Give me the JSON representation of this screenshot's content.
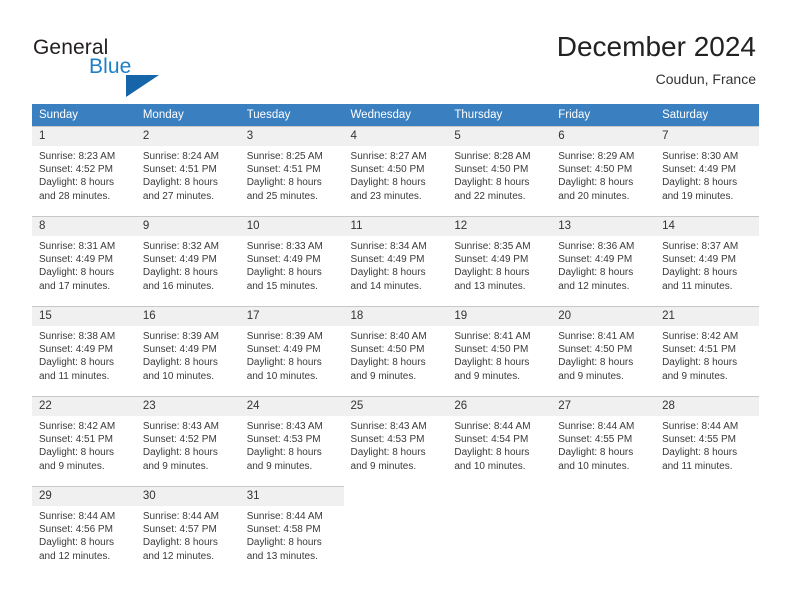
{
  "brand": {
    "name_part1": "General",
    "name_part2": "Blue",
    "accent_color": "#1f7fc4",
    "triangle_color": "#1565a8"
  },
  "header": {
    "title": "December 2024",
    "subtitle": "Coudun, France"
  },
  "calendar": {
    "header_bg": "#3a7fc0",
    "daynum_bg": "#f0f0f0",
    "weekday_headers": [
      "Sunday",
      "Monday",
      "Tuesday",
      "Wednesday",
      "Thursday",
      "Friday",
      "Saturday"
    ],
    "weeks": [
      [
        {
          "day": "1",
          "sunrise": "Sunrise: 8:23 AM",
          "sunset": "Sunset: 4:52 PM",
          "daylight1": "Daylight: 8 hours",
          "daylight2": "and 28 minutes."
        },
        {
          "day": "2",
          "sunrise": "Sunrise: 8:24 AM",
          "sunset": "Sunset: 4:51 PM",
          "daylight1": "Daylight: 8 hours",
          "daylight2": "and 27 minutes."
        },
        {
          "day": "3",
          "sunrise": "Sunrise: 8:25 AM",
          "sunset": "Sunset: 4:51 PM",
          "daylight1": "Daylight: 8 hours",
          "daylight2": "and 25 minutes."
        },
        {
          "day": "4",
          "sunrise": "Sunrise: 8:27 AM",
          "sunset": "Sunset: 4:50 PM",
          "daylight1": "Daylight: 8 hours",
          "daylight2": "and 23 minutes."
        },
        {
          "day": "5",
          "sunrise": "Sunrise: 8:28 AM",
          "sunset": "Sunset: 4:50 PM",
          "daylight1": "Daylight: 8 hours",
          "daylight2": "and 22 minutes."
        },
        {
          "day": "6",
          "sunrise": "Sunrise: 8:29 AM",
          "sunset": "Sunset: 4:50 PM",
          "daylight1": "Daylight: 8 hours",
          "daylight2": "and 20 minutes."
        },
        {
          "day": "7",
          "sunrise": "Sunrise: 8:30 AM",
          "sunset": "Sunset: 4:49 PM",
          "daylight1": "Daylight: 8 hours",
          "daylight2": "and 19 minutes."
        }
      ],
      [
        {
          "day": "8",
          "sunrise": "Sunrise: 8:31 AM",
          "sunset": "Sunset: 4:49 PM",
          "daylight1": "Daylight: 8 hours",
          "daylight2": "and 17 minutes."
        },
        {
          "day": "9",
          "sunrise": "Sunrise: 8:32 AM",
          "sunset": "Sunset: 4:49 PM",
          "daylight1": "Daylight: 8 hours",
          "daylight2": "and 16 minutes."
        },
        {
          "day": "10",
          "sunrise": "Sunrise: 8:33 AM",
          "sunset": "Sunset: 4:49 PM",
          "daylight1": "Daylight: 8 hours",
          "daylight2": "and 15 minutes."
        },
        {
          "day": "11",
          "sunrise": "Sunrise: 8:34 AM",
          "sunset": "Sunset: 4:49 PM",
          "daylight1": "Daylight: 8 hours",
          "daylight2": "and 14 minutes."
        },
        {
          "day": "12",
          "sunrise": "Sunrise: 8:35 AM",
          "sunset": "Sunset: 4:49 PM",
          "daylight1": "Daylight: 8 hours",
          "daylight2": "and 13 minutes."
        },
        {
          "day": "13",
          "sunrise": "Sunrise: 8:36 AM",
          "sunset": "Sunset: 4:49 PM",
          "daylight1": "Daylight: 8 hours",
          "daylight2": "and 12 minutes."
        },
        {
          "day": "14",
          "sunrise": "Sunrise: 8:37 AM",
          "sunset": "Sunset: 4:49 PM",
          "daylight1": "Daylight: 8 hours",
          "daylight2": "and 11 minutes."
        }
      ],
      [
        {
          "day": "15",
          "sunrise": "Sunrise: 8:38 AM",
          "sunset": "Sunset: 4:49 PM",
          "daylight1": "Daylight: 8 hours",
          "daylight2": "and 11 minutes."
        },
        {
          "day": "16",
          "sunrise": "Sunrise: 8:39 AM",
          "sunset": "Sunset: 4:49 PM",
          "daylight1": "Daylight: 8 hours",
          "daylight2": "and 10 minutes."
        },
        {
          "day": "17",
          "sunrise": "Sunrise: 8:39 AM",
          "sunset": "Sunset: 4:49 PM",
          "daylight1": "Daylight: 8 hours",
          "daylight2": "and 10 minutes."
        },
        {
          "day": "18",
          "sunrise": "Sunrise: 8:40 AM",
          "sunset": "Sunset: 4:50 PM",
          "daylight1": "Daylight: 8 hours",
          "daylight2": "and 9 minutes."
        },
        {
          "day": "19",
          "sunrise": "Sunrise: 8:41 AM",
          "sunset": "Sunset: 4:50 PM",
          "daylight1": "Daylight: 8 hours",
          "daylight2": "and 9 minutes."
        },
        {
          "day": "20",
          "sunrise": "Sunrise: 8:41 AM",
          "sunset": "Sunset: 4:50 PM",
          "daylight1": "Daylight: 8 hours",
          "daylight2": "and 9 minutes."
        },
        {
          "day": "21",
          "sunrise": "Sunrise: 8:42 AM",
          "sunset": "Sunset: 4:51 PM",
          "daylight1": "Daylight: 8 hours",
          "daylight2": "and 9 minutes."
        }
      ],
      [
        {
          "day": "22",
          "sunrise": "Sunrise: 8:42 AM",
          "sunset": "Sunset: 4:51 PM",
          "daylight1": "Daylight: 8 hours",
          "daylight2": "and 9 minutes."
        },
        {
          "day": "23",
          "sunrise": "Sunrise: 8:43 AM",
          "sunset": "Sunset: 4:52 PM",
          "daylight1": "Daylight: 8 hours",
          "daylight2": "and 9 minutes."
        },
        {
          "day": "24",
          "sunrise": "Sunrise: 8:43 AM",
          "sunset": "Sunset: 4:53 PM",
          "daylight1": "Daylight: 8 hours",
          "daylight2": "and 9 minutes."
        },
        {
          "day": "25",
          "sunrise": "Sunrise: 8:43 AM",
          "sunset": "Sunset: 4:53 PM",
          "daylight1": "Daylight: 8 hours",
          "daylight2": "and 9 minutes."
        },
        {
          "day": "26",
          "sunrise": "Sunrise: 8:44 AM",
          "sunset": "Sunset: 4:54 PM",
          "daylight1": "Daylight: 8 hours",
          "daylight2": "and 10 minutes."
        },
        {
          "day": "27",
          "sunrise": "Sunrise: 8:44 AM",
          "sunset": "Sunset: 4:55 PM",
          "daylight1": "Daylight: 8 hours",
          "daylight2": "and 10 minutes."
        },
        {
          "day": "28",
          "sunrise": "Sunrise: 8:44 AM",
          "sunset": "Sunset: 4:55 PM",
          "daylight1": "Daylight: 8 hours",
          "daylight2": "and 11 minutes."
        }
      ],
      [
        {
          "day": "29",
          "sunrise": "Sunrise: 8:44 AM",
          "sunset": "Sunset: 4:56 PM",
          "daylight1": "Daylight: 8 hours",
          "daylight2": "and 12 minutes."
        },
        {
          "day": "30",
          "sunrise": "Sunrise: 8:44 AM",
          "sunset": "Sunset: 4:57 PM",
          "daylight1": "Daylight: 8 hours",
          "daylight2": "and 12 minutes."
        },
        {
          "day": "31",
          "sunrise": "Sunrise: 8:44 AM",
          "sunset": "Sunset: 4:58 PM",
          "daylight1": "Daylight: 8 hours",
          "daylight2": "and 13 minutes."
        },
        {
          "day": "",
          "sunrise": "",
          "sunset": "",
          "daylight1": "",
          "daylight2": ""
        },
        {
          "day": "",
          "sunrise": "",
          "sunset": "",
          "daylight1": "",
          "daylight2": ""
        },
        {
          "day": "",
          "sunrise": "",
          "sunset": "",
          "daylight1": "",
          "daylight2": ""
        },
        {
          "day": "",
          "sunrise": "",
          "sunset": "",
          "daylight1": "",
          "daylight2": ""
        }
      ]
    ]
  }
}
